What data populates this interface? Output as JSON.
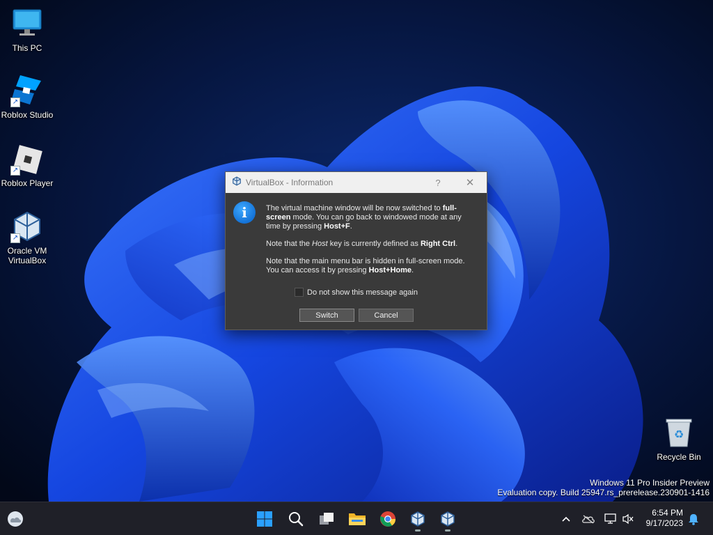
{
  "desktop": {
    "icons": [
      {
        "label": "This PC",
        "icon": "monitor-icon"
      },
      {
        "label": "Roblox Studio",
        "icon": "roblox-studio-icon"
      },
      {
        "label": "Roblox Player",
        "icon": "roblox-player-icon"
      },
      {
        "label": "Oracle VM VirtualBox",
        "icon": "virtualbox-icon"
      },
      {
        "label": "Recycle Bin",
        "icon": "recycle-bin-icon"
      }
    ],
    "watermark": {
      "line1": "Windows 11 Pro Insider Preview",
      "line2": "Evaluation copy. Build 25947.rs_prerelease.230901-1416"
    }
  },
  "dialog": {
    "title": "VirtualBox - Information",
    "help": "?",
    "close": "✕",
    "info_glyph": "i",
    "msg1": {
      "a": "The virtual machine window will be now switched to ",
      "b": "full-screen",
      "c": " mode. You can go back to windowed mode at any time by pressing ",
      "d": "Host+F",
      "e": "."
    },
    "msg2": {
      "a": "Note that the ",
      "b": "Host",
      "c": " key is currently defined as ",
      "d": "Right Ctrl",
      "e": "."
    },
    "msg3": {
      "a": "Note that the main menu bar is hidden in full-screen mode. You can access it by pressing ",
      "b": "Host+Home",
      "c": "."
    },
    "checkbox_label": "Do not show this message again",
    "checkbox_checked": false,
    "switch_label": "Switch",
    "cancel_label": "Cancel"
  },
  "taskbar": {
    "items": [
      "weather-icon",
      "start-icon",
      "search-icon",
      "task-view-icon",
      "file-explorer-icon",
      "chrome-icon",
      "virtualbox-taskbar-icon",
      "virtualbox-vm-taskbar-icon"
    ],
    "time": "6:54 PM",
    "date": "9/17/2023",
    "tray": [
      "show-hidden-icons-chevron",
      "onedrive-icon",
      "network-icon",
      "volume-muted-icon",
      "notification-bell-icon"
    ]
  },
  "colors": {
    "accent": "#1473d8",
    "dialog_bg": "#3a3a3a",
    "taskbar_bg": "#1f2028"
  }
}
